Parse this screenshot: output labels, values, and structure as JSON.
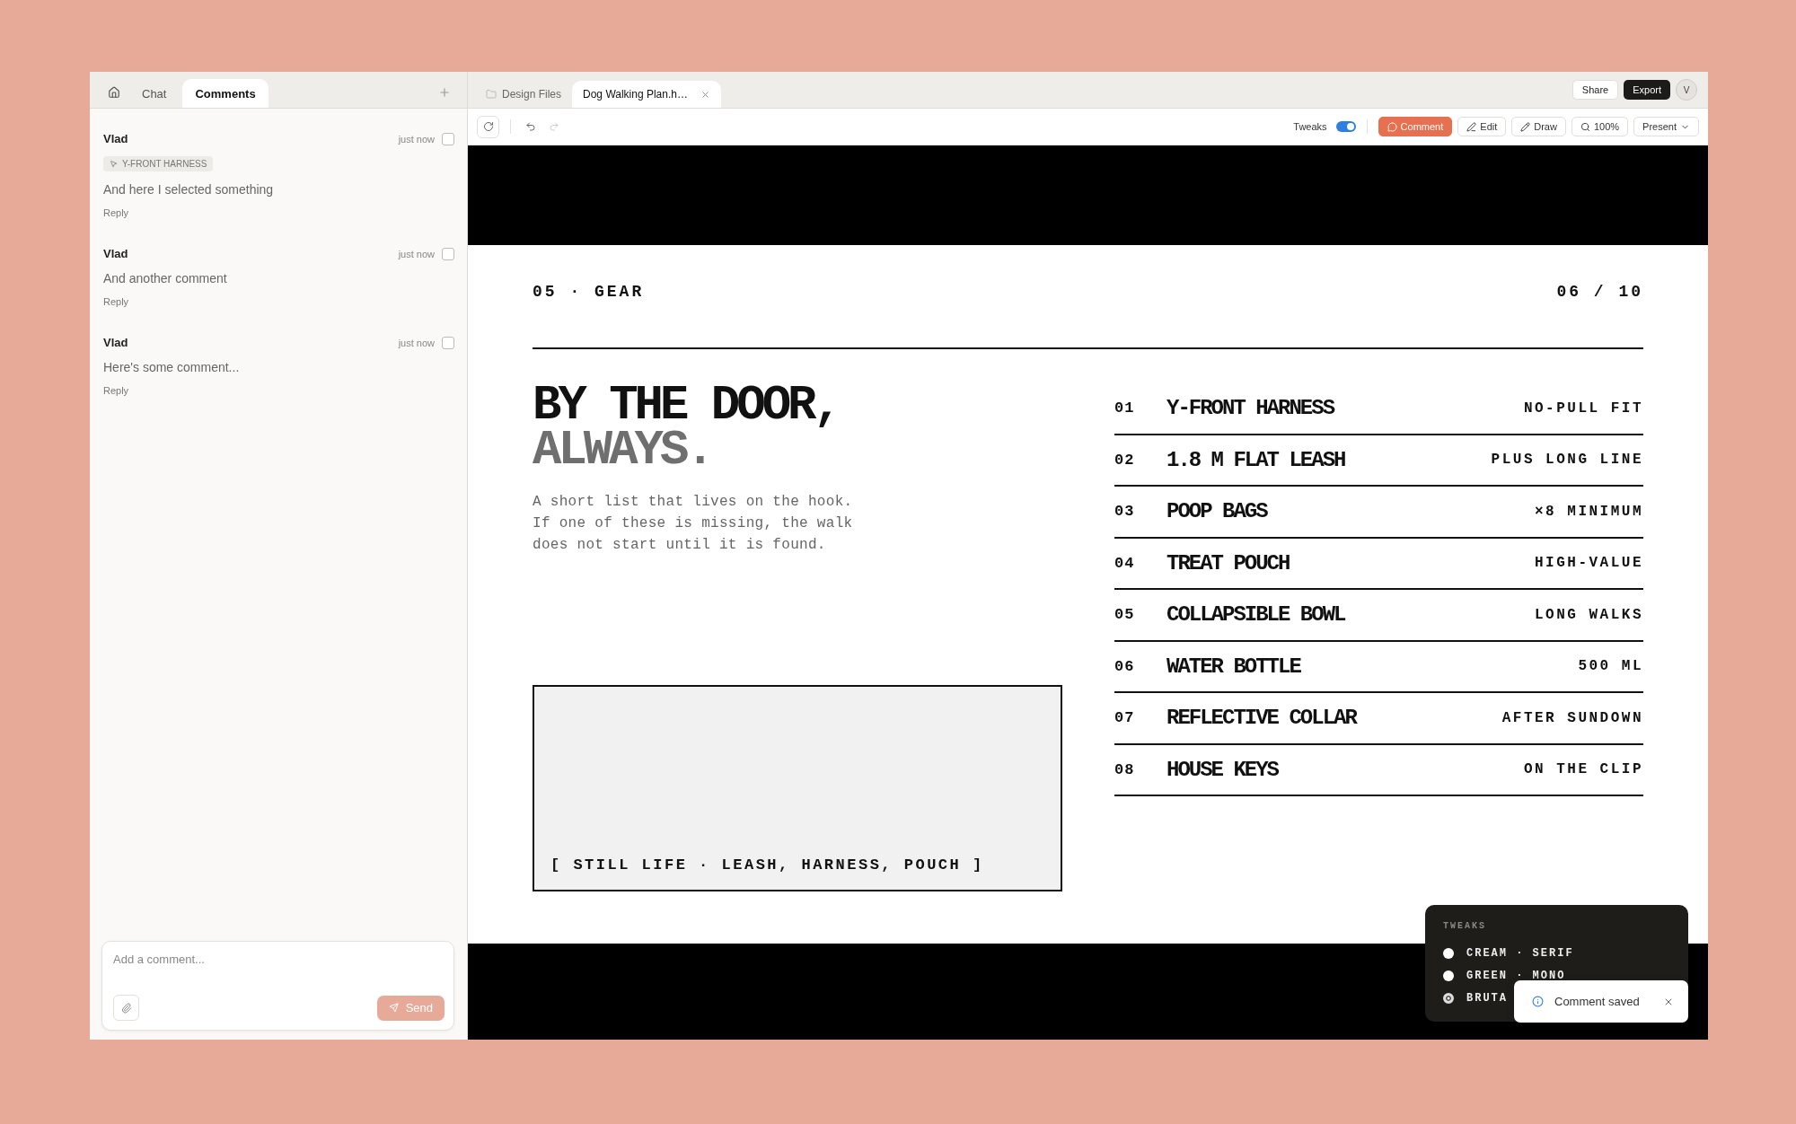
{
  "sidebar": {
    "tabs": [
      {
        "label": "Chat",
        "selected": false
      },
      {
        "label": "Comments",
        "selected": true
      }
    ],
    "comments": [
      {
        "author": "Vlad",
        "time": "just now",
        "resolved": false,
        "tag": "Y-FRONT HARNESS",
        "text": "And here I selected something",
        "reply": "Reply"
      },
      {
        "author": "Vlad",
        "time": "just now",
        "resolved": false,
        "text": "And another comment",
        "reply": "Reply"
      },
      {
        "author": "Vlad",
        "time": "just now",
        "resolved": false,
        "text": "Here's some comment...",
        "reply": "Reply"
      }
    ],
    "composer": {
      "placeholder": "Add a comment...",
      "send": "Send"
    }
  },
  "file_tabs": [
    {
      "label": "Design Files",
      "selected": false
    },
    {
      "label": "Dog Walking Plan.h…",
      "selected": true
    }
  ],
  "header_actions": {
    "share": "Share",
    "export": "Export",
    "avatar": "V"
  },
  "toolbar": {
    "tweaks_label": "Tweaks",
    "tweaks_on": true,
    "buttons": [
      {
        "kind": "comment",
        "label": "Comment",
        "selected": true
      },
      {
        "kind": "edit",
        "label": "Edit",
        "selected": false
      },
      {
        "kind": "draw",
        "label": "Draw",
        "selected": false
      },
      {
        "kind": "zoom",
        "label": "100%",
        "selected": false
      },
      {
        "kind": "present",
        "label": "Present",
        "selected": false
      }
    ]
  },
  "slide": {
    "section": "05 · GEAR",
    "page": "06 / 10",
    "headline": "BY THE DOOR,",
    "headline_accent": "ALWAYS.",
    "description": "A short list that lives on the hook.\nIf one of these is missing, the walk\ndoes not start until it is found.",
    "picture_caption": "[ STILL LIFE · LEASH, HARNESS, POUCH ]",
    "items": [
      {
        "number": "01",
        "name": "Y-FRONT HARNESS",
        "note": "NO-PULL FIT"
      },
      {
        "number": "02",
        "name": "1.8 M FLAT LEASH",
        "note": "PLUS LONG LINE"
      },
      {
        "number": "03",
        "name": "POOP BAGS",
        "note": "×8 MINIMUM"
      },
      {
        "number": "04",
        "name": "TREAT POUCH",
        "note": "HIGH-VALUE"
      },
      {
        "number": "05",
        "name": "COLLAPSIBLE BOWL",
        "note": "LONG WALKS"
      },
      {
        "number": "06",
        "name": "WATER BOTTLE",
        "note": "500 ML"
      },
      {
        "number": "07",
        "name": "REFLECTIVE COLLAR",
        "note": "AFTER SUNDOWN"
      },
      {
        "number": "08",
        "name": "HOUSE KEYS",
        "note": "ON THE CLIP"
      }
    ]
  },
  "tweaks_panel": {
    "title": "TWEAKS",
    "options": [
      {
        "label": "CREAM · SERIF",
        "selected": false
      },
      {
        "label": "GREEN · MONO",
        "selected": false
      },
      {
        "label": "BRUTA",
        "selected": true
      }
    ]
  },
  "toast": {
    "text": "Comment saved"
  }
}
